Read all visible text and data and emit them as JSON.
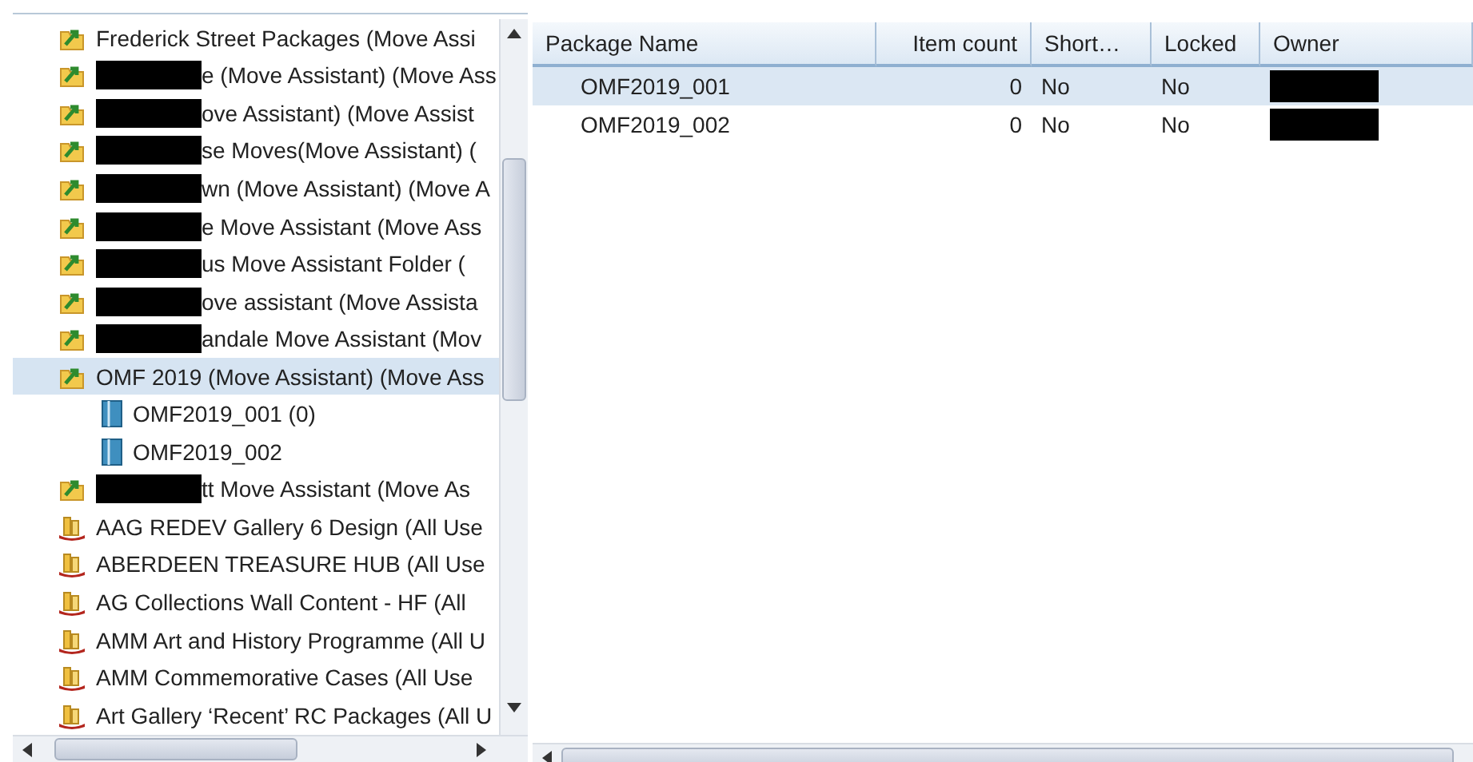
{
  "tree": {
    "items": [
      {
        "kind": "move_folder",
        "label": "Frederick Street Packages (Move Assi",
        "redacted": false,
        "selected": false
      },
      {
        "kind": "move_folder",
        "label": "e (Move Assistant) (Move Ass",
        "redacted": true,
        "selected": false
      },
      {
        "kind": "move_folder",
        "label": "ove Assistant) (Move Assist",
        "redacted": true,
        "selected": false
      },
      {
        "kind": "move_folder",
        "label": "se Moves(Move Assistant) (",
        "redacted": true,
        "selected": false
      },
      {
        "kind": "move_folder",
        "label": "wn (Move Assistant) (Move A",
        "redacted": true,
        "selected": false
      },
      {
        "kind": "move_folder",
        "label": "e Move Assistant (Move Ass",
        "redacted": true,
        "selected": false
      },
      {
        "kind": "move_folder",
        "label": "us Move Assistant Folder (",
        "redacted": true,
        "selected": false
      },
      {
        "kind": "move_folder",
        "label": "ove assistant (Move Assista",
        "redacted": true,
        "selected": false
      },
      {
        "kind": "move_folder",
        "label": "andale Move Assistant (Mov",
        "redacted": true,
        "selected": false
      },
      {
        "kind": "move_folder",
        "label": "OMF 2019 (Move Assistant) (Move Ass",
        "redacted": false,
        "selected": true,
        "children": [
          {
            "kind": "package",
            "label": "OMF2019_001 (0)",
            "redacted": false,
            "selected": false
          },
          {
            "kind": "package",
            "label": "OMF2019_002",
            "redacted": false,
            "selected": false
          }
        ]
      },
      {
        "kind": "move_folder",
        "label": "tt Move Assistant (Move As",
        "redacted": true,
        "selected": false
      },
      {
        "kind": "shared_folder",
        "label": "AAG REDEV Gallery 6 Design (All Use",
        "redacted": false,
        "selected": false
      },
      {
        "kind": "shared_folder",
        "label": "ABERDEEN TREASURE HUB (All Use",
        "redacted": false,
        "selected": false
      },
      {
        "kind": "shared_folder",
        "label": "AG Collections Wall Content - HF (All",
        "redacted": false,
        "selected": false
      },
      {
        "kind": "shared_folder",
        "label": "AMM Art and History Programme (All U",
        "redacted": false,
        "selected": false
      },
      {
        "kind": "shared_folder",
        "label": "AMM Commemorative Cases (All Use",
        "redacted": false,
        "selected": false
      },
      {
        "kind": "shared_folder",
        "label": "Art Gallery ‘Recent’ RC Packages (All U",
        "redacted": false,
        "selected": false
      }
    ]
  },
  "table": {
    "columns": [
      "Package Name",
      "Item count",
      "Short…",
      "Locked",
      "Owner"
    ],
    "rows": [
      {
        "name": "OMF2019_001",
        "item_count": "0",
        "short": "No",
        "locked": "No",
        "owner_redacted": true,
        "selected": true
      },
      {
        "name": "OMF2019_002",
        "item_count": "0",
        "short": "No",
        "locked": "No",
        "owner_redacted": true,
        "selected": false
      }
    ]
  }
}
